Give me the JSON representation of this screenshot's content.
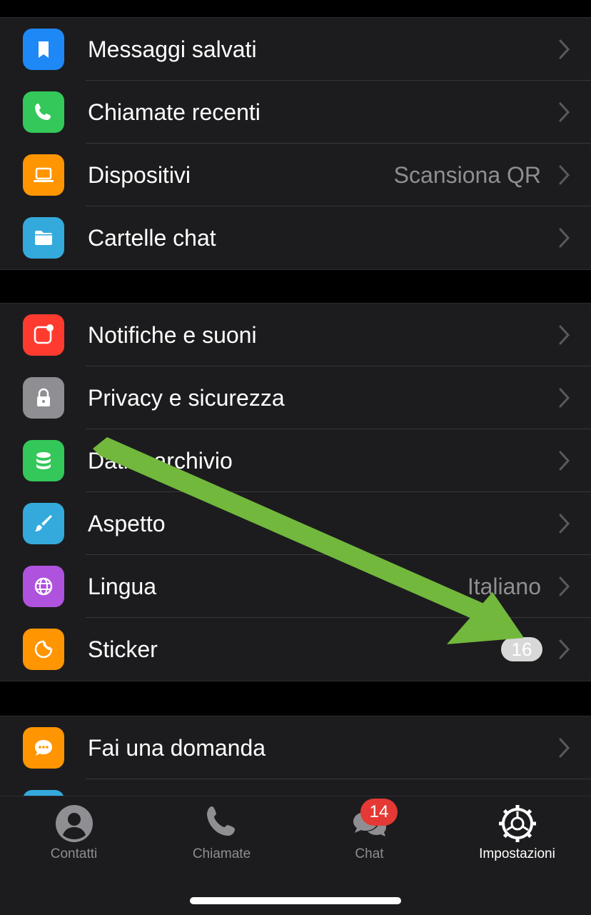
{
  "group1": [
    {
      "label": "Messaggi salvati",
      "icon": "bookmark-icon",
      "color": "#1e88f7"
    },
    {
      "label": "Chiamate recenti",
      "icon": "phone-icon",
      "color": "#34c759"
    },
    {
      "label": "Dispositivi",
      "value": "Scansiona QR",
      "icon": "laptop-icon",
      "color": "#ff9500"
    },
    {
      "label": "Cartelle chat",
      "icon": "folder-icon",
      "color": "#34aadc"
    }
  ],
  "group2": [
    {
      "label": "Notifiche e suoni",
      "icon": "notification-icon",
      "color": "#ff3b30"
    },
    {
      "label": "Privacy e sicurezza",
      "icon": "lock-icon",
      "color": "#8e8e93"
    },
    {
      "label": "Dati e archivio",
      "icon": "database-icon",
      "color": "#34c759"
    },
    {
      "label": "Aspetto",
      "icon": "brush-icon",
      "color": "#34aadc"
    },
    {
      "label": "Lingua",
      "value": "Italiano",
      "icon": "globe-icon",
      "color": "#af52de"
    },
    {
      "label": "Sticker",
      "badge": "16",
      "icon": "sticker-icon",
      "color": "#ff9500"
    }
  ],
  "group3": [
    {
      "label": "Fai una domanda",
      "icon": "chat-bubble-icon",
      "color": "#ff9500"
    }
  ],
  "tabs": [
    {
      "label": "Contatti",
      "icon": "person-icon"
    },
    {
      "label": "Chiamate",
      "icon": "phone-icon"
    },
    {
      "label": "Chat",
      "icon": "chat-bubbles-icon",
      "badge": "14"
    },
    {
      "label": "Impostazioni",
      "icon": "gear-icon",
      "active": true
    }
  ],
  "annotation": {
    "type": "arrow",
    "color": "#72b83c"
  }
}
